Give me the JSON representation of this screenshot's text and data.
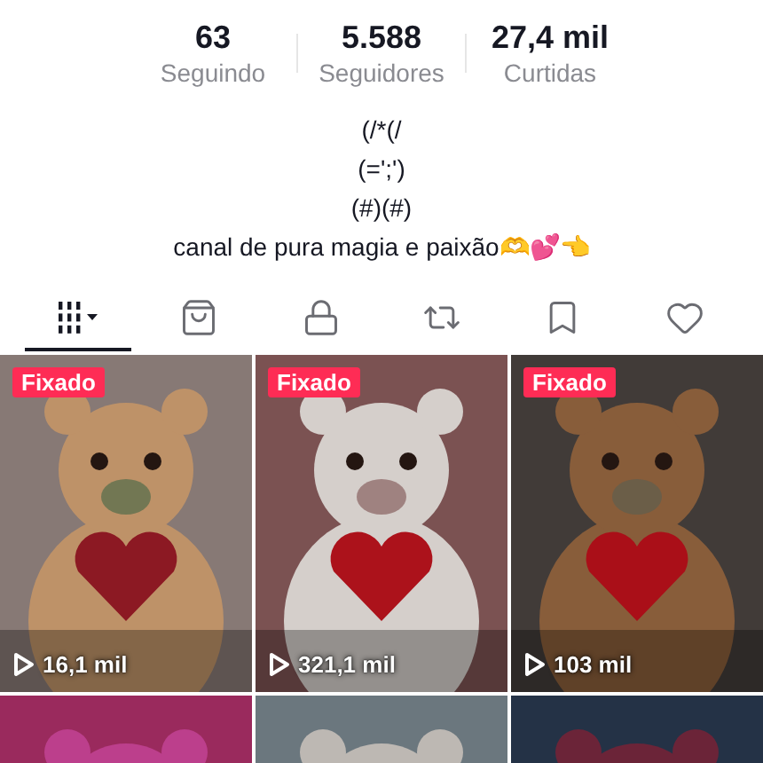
{
  "stats": [
    {
      "value": "63",
      "label": "Seguindo"
    },
    {
      "value": "5.588",
      "label": "Seguidores"
    },
    {
      "value": "27,4 mil",
      "label": "Curtidas"
    }
  ],
  "bio": [
    "(/*(/",
    "(=';')",
    "(#)(#)",
    "canal de pura magia e paixão🫶💕👈"
  ],
  "tabs": [
    {
      "kind": "videos",
      "selected": true
    },
    {
      "kind": "shop",
      "selected": false
    },
    {
      "kind": "private",
      "selected": false
    },
    {
      "kind": "reposts",
      "selected": false
    },
    {
      "kind": "saved",
      "selected": false
    },
    {
      "kind": "liked",
      "selected": false
    }
  ],
  "videos": [
    {
      "pinned": true,
      "badge": "Fixado",
      "views": "16,1 mil"
    },
    {
      "pinned": true,
      "badge": "Fixado",
      "views": "321,1 mil"
    },
    {
      "pinned": true,
      "badge": "Fixado",
      "views": "103 mil"
    },
    {
      "pinned": false
    },
    {
      "pinned": false
    },
    {
      "pinned": false
    }
  ]
}
